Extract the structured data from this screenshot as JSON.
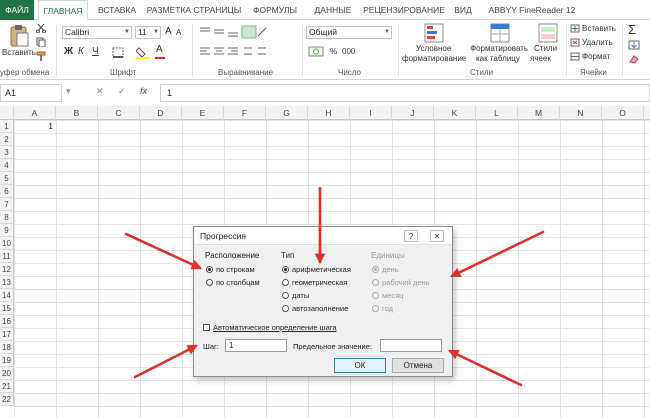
{
  "tabs": {
    "file": "ФАЙЛ",
    "home": "ГЛАВНАЯ",
    "insert": "ВСТАВКА",
    "page_layout": "РАЗМЕТКА СТРАНИЦЫ",
    "formulas": "ФОРМУЛЫ",
    "data": "ДАННЫЕ",
    "review": "РЕЦЕНЗИРОВАНИЕ",
    "view": "ВИД",
    "abbyy": "ABBYY FineReader 12"
  },
  "ribbon": {
    "paste_label": "Вставить",
    "clipboard_label": "уфер обмена",
    "font_name": "Calibri",
    "font_size": "11",
    "font_group_label": "Шрифт",
    "bold": "Ж",
    "italic": "К",
    "underline": "Ч",
    "alignment_label": "Выравнивание",
    "number_format": "Общий",
    "number_label": "Число",
    "conditional_formatting_line1": "Условное",
    "conditional_formatting_line2": "форматирование",
    "format_as_table_line1": "Форматировать",
    "format_as_table_line2": "как таблицу",
    "cell_styles_line1": "Стили",
    "cell_styles_line2": "ячеек",
    "styles_label": "Стили",
    "insert_cells": "Вставить",
    "delete_cells": "Удалить",
    "format_cells": "Формат",
    "cells_label": "Ячейки",
    "increase_font": "A",
    "decrease_font": "A",
    "font_color_letter": "A",
    "thousands": "000",
    "percent": "%"
  },
  "formula_bar": {
    "name_box": "A1",
    "cancel": "✕",
    "enter": "✓",
    "fx": "fx",
    "value": "1"
  },
  "grid": {
    "columns": [
      "A",
      "B",
      "C",
      "D",
      "E",
      "F",
      "G",
      "H",
      "I",
      "J",
      "K",
      "L",
      "M",
      "N",
      "O"
    ],
    "rows": [
      "1",
      "2",
      "3",
      "4",
      "5",
      "6",
      "7",
      "8",
      "9",
      "10",
      "11",
      "12",
      "13",
      "14",
      "15",
      "16",
      "17",
      "18",
      "19",
      "20",
      "21",
      "22"
    ],
    "a1_value": "1"
  },
  "dialog": {
    "title": "Прогрессия",
    "help": "?",
    "close": "✕",
    "location_label": "Расположение",
    "by_rows": "по строкам",
    "by_columns": "по столбцам",
    "type_label": "Тип",
    "arithmetic": "арифметическая",
    "geometric": "геометрическая",
    "dates": "даты",
    "autofill": "автозаполнение",
    "units_label": "Единицы",
    "day": "день",
    "workday": "рабочий день",
    "month": "месяц",
    "year": "год",
    "auto_step": "Автоматическое определение шага",
    "step_label": "Шаг:",
    "step_value": "1",
    "limit_label": "Предельное значение:",
    "limit_value": "",
    "ok": "ОК",
    "cancel": "Отмена"
  },
  "colors": {
    "accent": "#217346",
    "arrow": "#d9342b",
    "dialog_bg": "#f0f0f0"
  }
}
